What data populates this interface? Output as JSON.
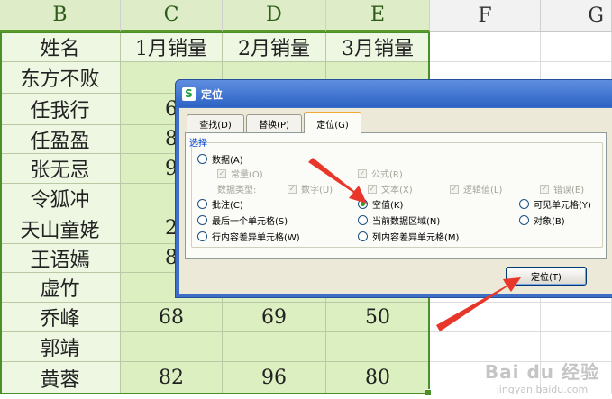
{
  "sheet": {
    "columns": [
      "B",
      "C",
      "D",
      "E",
      "F",
      "G"
    ],
    "header_row": [
      "姓名",
      "1月销量",
      "2月销量",
      "3月销量"
    ],
    "names": [
      "东方不败",
      "任我行",
      "任盈盈",
      "张无忌",
      "令狐冲",
      "天山童姥",
      "王语嫣",
      "虚竹",
      "乔峰",
      "郭靖",
      "黄蓉"
    ],
    "rows": [
      {
        "c": "",
        "d": "",
        "e": ""
      },
      {
        "c": "6",
        "d": "",
        "e": ""
      },
      {
        "c": "8",
        "d": "",
        "e": ""
      },
      {
        "c": "9",
        "d": "",
        "e": ""
      },
      {
        "c": "",
        "d": "",
        "e": ""
      },
      {
        "c": "2",
        "d": "",
        "e": ""
      },
      {
        "c": "8",
        "d": "",
        "e": ""
      },
      {
        "c": "",
        "d": "",
        "e": ""
      },
      {
        "c": "68",
        "d": "69",
        "e": "50"
      },
      {
        "c": "",
        "d": "",
        "e": ""
      },
      {
        "c": "82",
        "d": "96",
        "e": "80"
      }
    ],
    "selection_color": "#4a8f2a"
  },
  "dialog": {
    "title": "定位",
    "app_icon": "wps-s-icon",
    "tabs": [
      "查找(D)",
      "替换(P)",
      "定位(G)"
    ],
    "active_tab": "定位(G)",
    "group_label": "选择",
    "options": {
      "data": "数据(A)",
      "constants": "常量(O)",
      "formulas": "公式(R)",
      "data_type_label": "数据类型:",
      "number": "数字(U)",
      "text": "文本(X)",
      "logical": "逻辑值(L)",
      "error": "错误(E)",
      "comments": "批注(C)",
      "blanks": "空值(K)",
      "visible_cells": "可见单元格(Y)",
      "last_cell": "最后一个单元格(S)",
      "current_region": "当前数据区域(N)",
      "objects": "对象(B)",
      "row_diff": "行内容差异单元格(W)",
      "col_diff": "列内容差异单元格(M)"
    },
    "selected_option": "空值(K)",
    "locate_button": "定位(T)"
  },
  "watermark": {
    "logo": "Bai du 经验",
    "url": "jingyan.baidu.com"
  },
  "annotation_color": "#e8372a"
}
